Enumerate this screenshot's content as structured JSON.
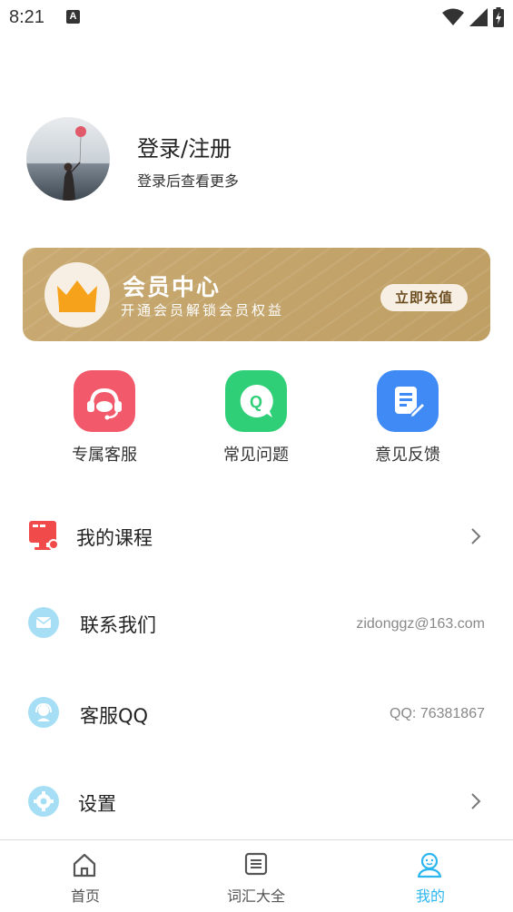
{
  "status_bar": {
    "time": "8:21",
    "notification_letter": "A"
  },
  "profile": {
    "title": "登录/注册",
    "subtitle": "登录后查看更多"
  },
  "vip": {
    "title": "会员中心",
    "subtitle": "开通会员解锁会员权益",
    "button": "立即充值"
  },
  "quick_actions": [
    {
      "label": "专属客服",
      "icon": "headset-icon",
      "color": "#f25a6b"
    },
    {
      "label": "常见问题",
      "icon": "question-chat-icon",
      "color": "#2fcf77"
    },
    {
      "label": "意见反馈",
      "icon": "feedback-edit-icon",
      "color": "#3f8af5"
    }
  ],
  "menu": [
    {
      "label": "我的课程",
      "value": "",
      "icon": "course-icon",
      "has_chevron": true
    },
    {
      "label": "联系我们",
      "value": "zidonggz@163.com",
      "icon": "mail-icon",
      "has_chevron": false
    },
    {
      "label": "客服QQ",
      "value": "QQ: 76381867",
      "icon": "support-icon",
      "has_chevron": false
    },
    {
      "label": "设置",
      "value": "",
      "icon": "settings-icon",
      "has_chevron": true
    }
  ],
  "bottom_nav": [
    {
      "label": "首页",
      "icon": "home-icon",
      "active": false
    },
    {
      "label": "词汇大全",
      "icon": "list-icon",
      "active": false
    },
    {
      "label": "我的",
      "icon": "profile-icon",
      "active": true
    }
  ],
  "colors": {
    "active_nav": "#2bb6ef",
    "inactive_nav": "#555555",
    "menu_icon_circle": "#a6dff5",
    "vip_gold": "#c4a56c"
  }
}
